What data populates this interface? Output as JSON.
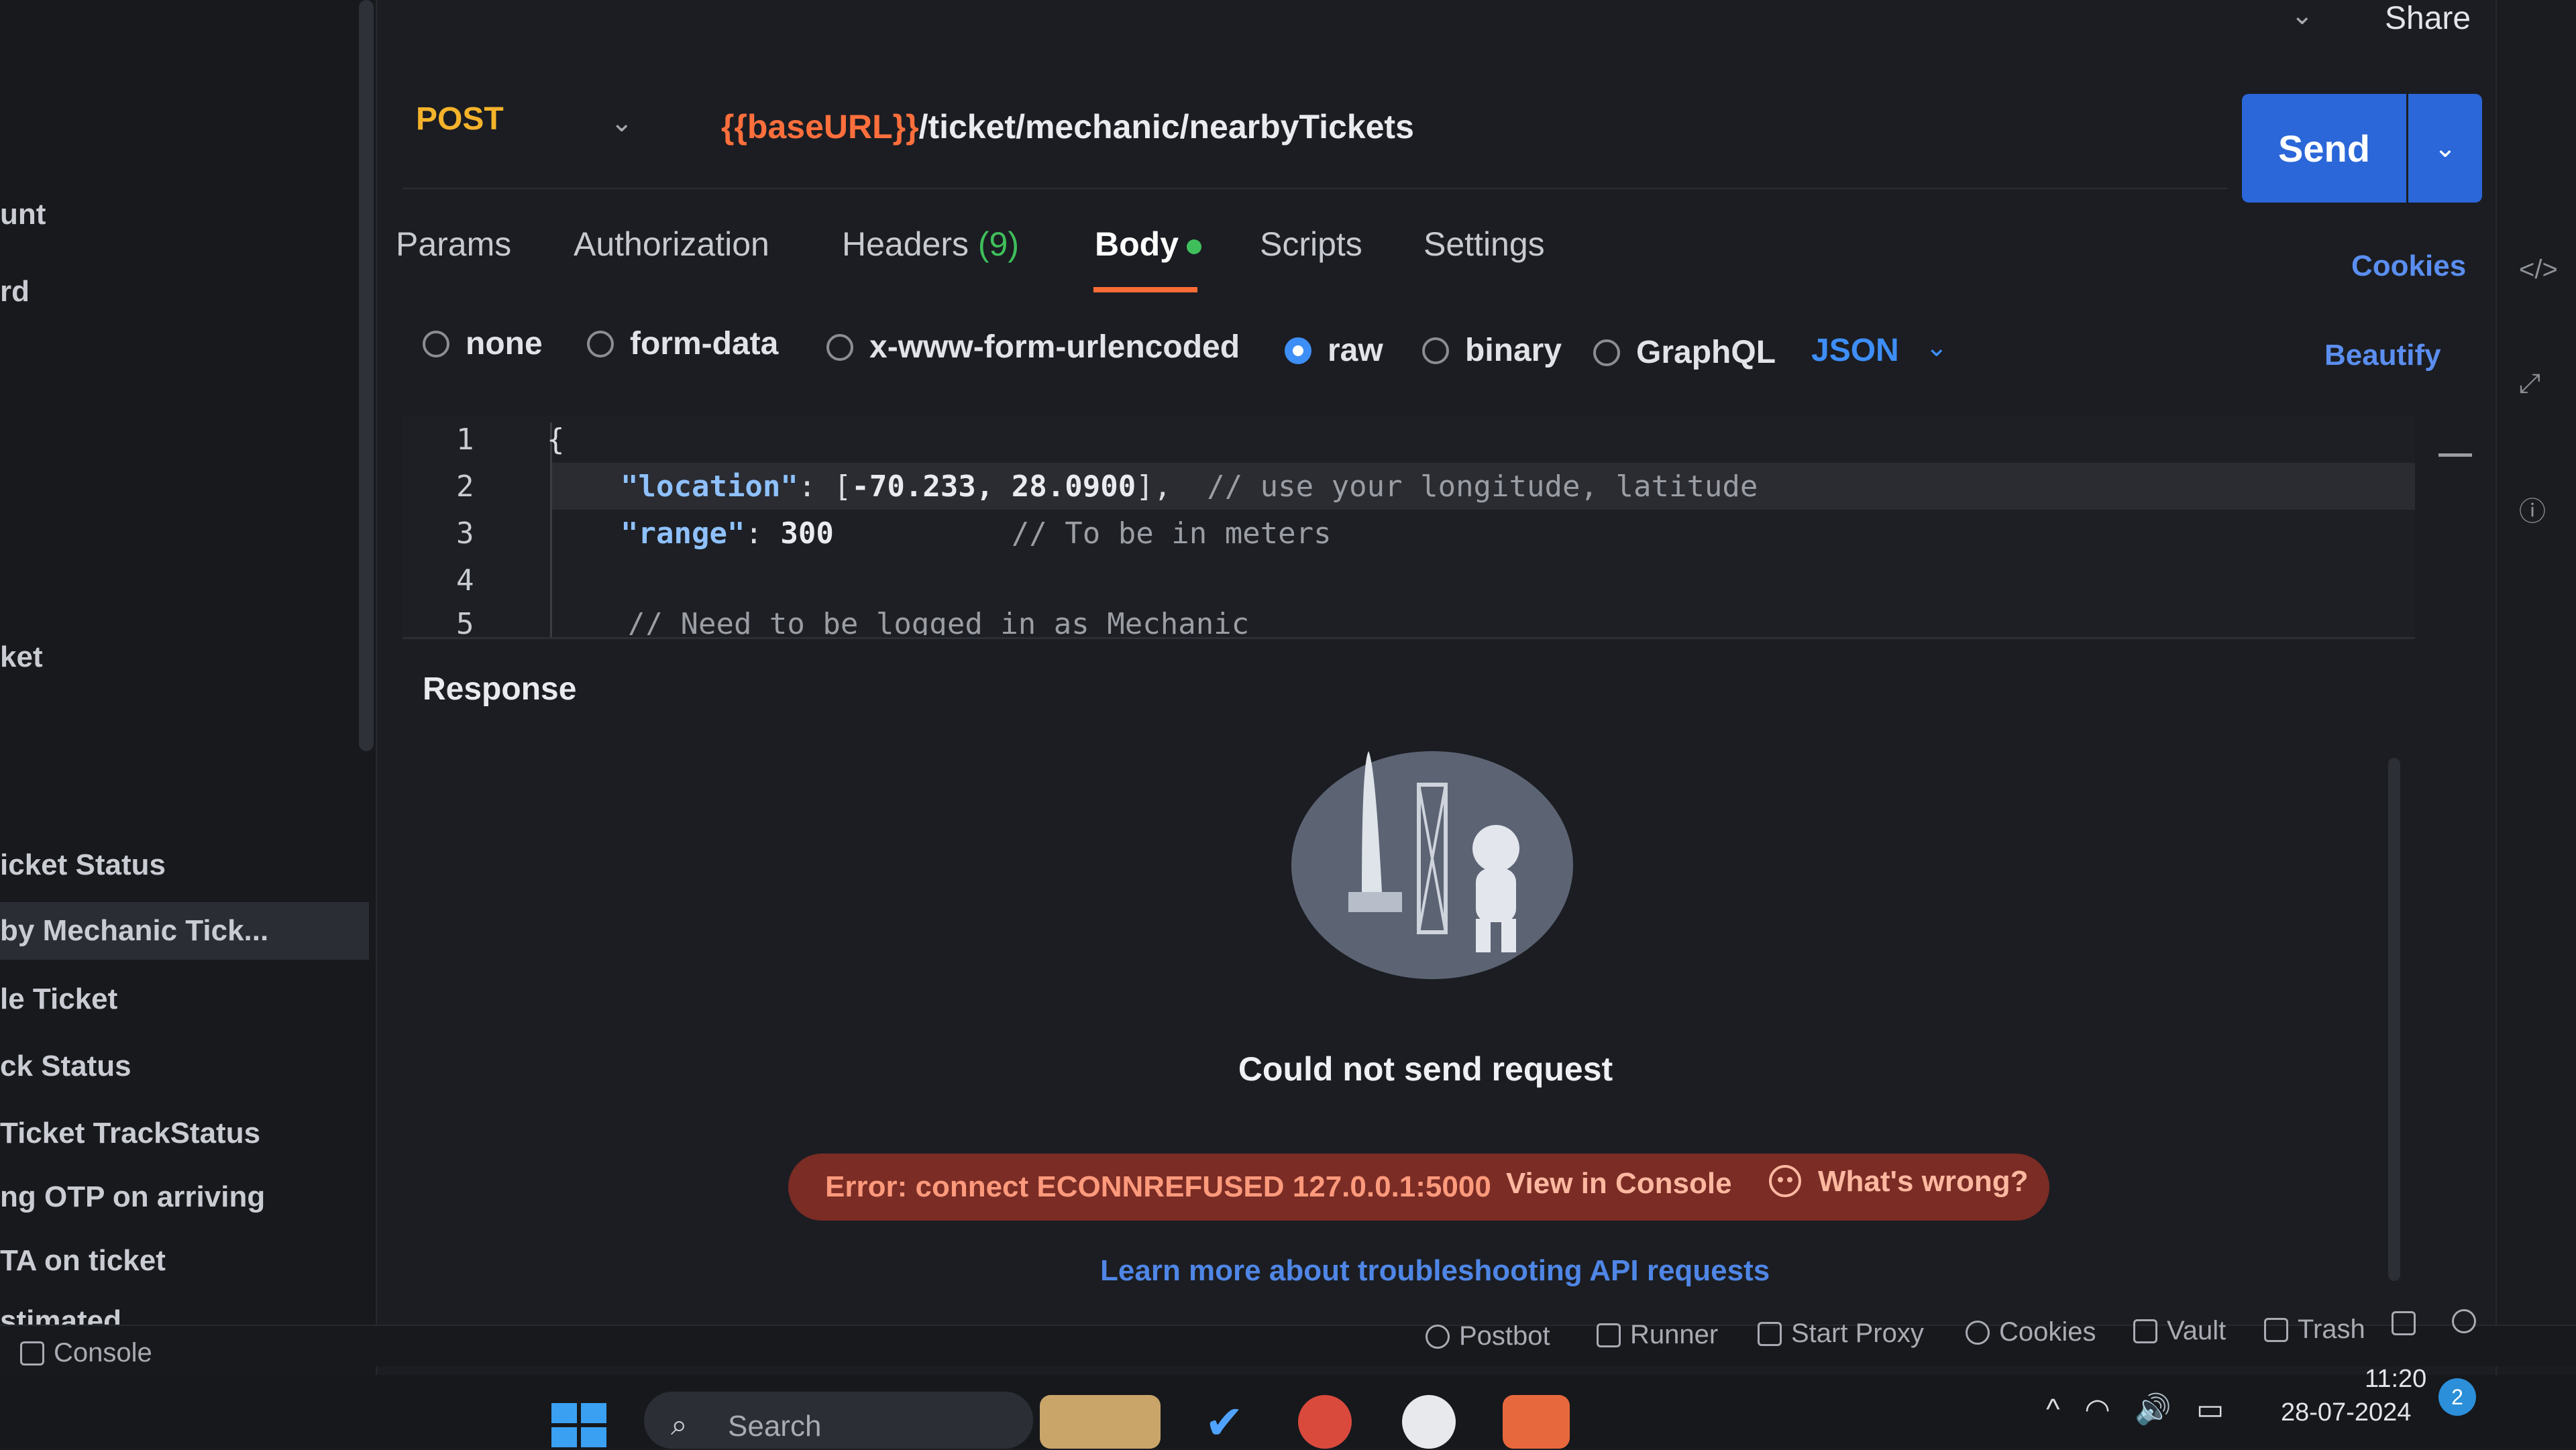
{
  "sidebar": {
    "items": [
      {
        "label": "unt"
      },
      {
        "label": "rd"
      },
      {
        "label": "ket"
      },
      {
        "label": "icket Status"
      },
      {
        "label": "by Mechanic Tick..."
      },
      {
        "label": "le Ticket"
      },
      {
        "label": "ck Status"
      },
      {
        "label": "Ticket TrackStatus"
      },
      {
        "label": "ng OTP on arriving"
      },
      {
        "label": "TA on ticket"
      },
      {
        "label": "stimated"
      }
    ]
  },
  "request": {
    "method": "POST",
    "url_var": "{{baseURL}}",
    "url_path": "/ticket/mechanic/nearbyTickets",
    "send_label": "Send",
    "share_label": "Share"
  },
  "tabs": {
    "params": "Params",
    "authorization": "Authorization",
    "headers": "Headers",
    "headers_count": "(9)",
    "body": "Body",
    "scripts": "Scripts",
    "settings": "Settings",
    "cookies": "Cookies"
  },
  "body_types": {
    "none": "none",
    "form_data": "form-data",
    "urlencoded": "x-www-form-urlencoded",
    "raw": "raw",
    "binary": "binary",
    "graphql": "GraphQL",
    "selected": "raw",
    "language": "JSON",
    "beautify": "Beautify"
  },
  "editor": {
    "line_numbers": [
      "1",
      "2",
      "3",
      "4",
      "5"
    ],
    "line1": "{",
    "line2_key": "\"location\"",
    "line2_sep": ": [",
    "line2_val": "-70.233, 28.0900",
    "line2_end": "],",
    "line2_comment": "// use your longitude, latitude",
    "line3_key": "\"range\"",
    "line3_sep": ": ",
    "line3_val": "300",
    "line3_comment": "// To be in meters",
    "line5": "// Need to be logged in as Mechanic"
  },
  "response": {
    "label": "Response",
    "title": "Could not send request",
    "error": "Error: connect ECONNREFUSED 127.0.0.1:5000",
    "view_console": "View in Console",
    "whats_wrong": "What's wrong?",
    "learn_more": "Learn more about troubleshooting API requests"
  },
  "statusbar": {
    "console": "Console",
    "postbot": "Postbot",
    "runner": "Runner",
    "start_proxy": "Start Proxy",
    "cookies": "Cookies",
    "vault": "Vault",
    "trash": "Trash"
  },
  "taskbar": {
    "search": "Search",
    "time": "11:20",
    "date": "28-07-2024"
  },
  "colors": {
    "method": "#f5b32b",
    "url_var": "#ff6f3c",
    "send": "#2b67d8",
    "accent_blue": "#3e8ef7",
    "body_dot": "#3fbf5b",
    "error_pill": "#7a2c25"
  }
}
